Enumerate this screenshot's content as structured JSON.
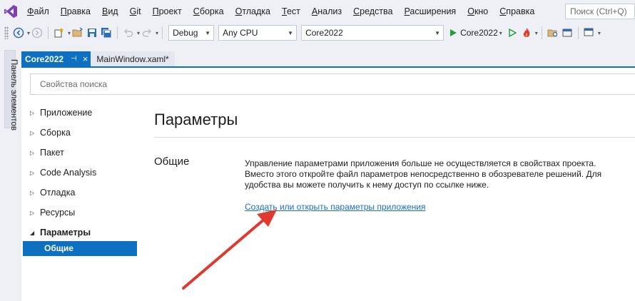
{
  "menubar": {
    "search_placeholder": "Поиск (Ctrl+Q)",
    "items": [
      {
        "ul": "Ф",
        "rest": "айл"
      },
      {
        "ul": "П",
        "rest": "равка"
      },
      {
        "ul": "В",
        "rest": "ид"
      },
      {
        "ul": "G",
        "rest": "it"
      },
      {
        "ul": "П",
        "rest": "роект"
      },
      {
        "ul": "С",
        "rest": "борка"
      },
      {
        "ul": "О",
        "rest": "тладка"
      },
      {
        "ul": "Т",
        "rest": "ест"
      },
      {
        "ul": "А",
        "rest": "нализ"
      },
      {
        "ul": "С",
        "rest": "редства"
      },
      {
        "ul": "Р",
        "rest": "асширения"
      },
      {
        "ul": "О",
        "rest": "кно"
      },
      {
        "ul": "С",
        "rest": "правка"
      }
    ]
  },
  "toolbar": {
    "config": "Debug",
    "platform": "Any CPU",
    "project": "Core2022",
    "run_target": "Core2022"
  },
  "side_panel": {
    "label": "Панель элементов"
  },
  "doc_tabs": {
    "active": "Core2022",
    "pin_glyph": "⊣",
    "close_glyph": "×",
    "other": "MainWindow.xaml*"
  },
  "content": {
    "search_placeholder": "Свойства поиска",
    "nav": [
      {
        "label": "Приложение",
        "expanded": false
      },
      {
        "label": "Сборка",
        "expanded": false
      },
      {
        "label": "Пакет",
        "expanded": false
      },
      {
        "label": "Code Analysis",
        "expanded": false
      },
      {
        "label": "Отладка",
        "expanded": false
      },
      {
        "label": "Ресурсы",
        "expanded": false
      },
      {
        "label": "Параметры",
        "expanded": true
      }
    ],
    "nav_selected_sub": "Общие",
    "page_title": "Параметры",
    "section_label": "Общие",
    "section_text": "Управление параметрами приложения больше не осуществляется в свойствах проекта. Вместо этого откройте файл параметров непосредственно в обозревателе решений. Для удобства вы можете получить к нему доступ по ссылке ниже.",
    "section_link": "Создать или открыть параметры приложения"
  },
  "colors": {
    "accent": "#0e70c0",
    "link": "#1a6fc4",
    "annotation_arrow": "#e0392f",
    "run": "#1f9e3a"
  }
}
